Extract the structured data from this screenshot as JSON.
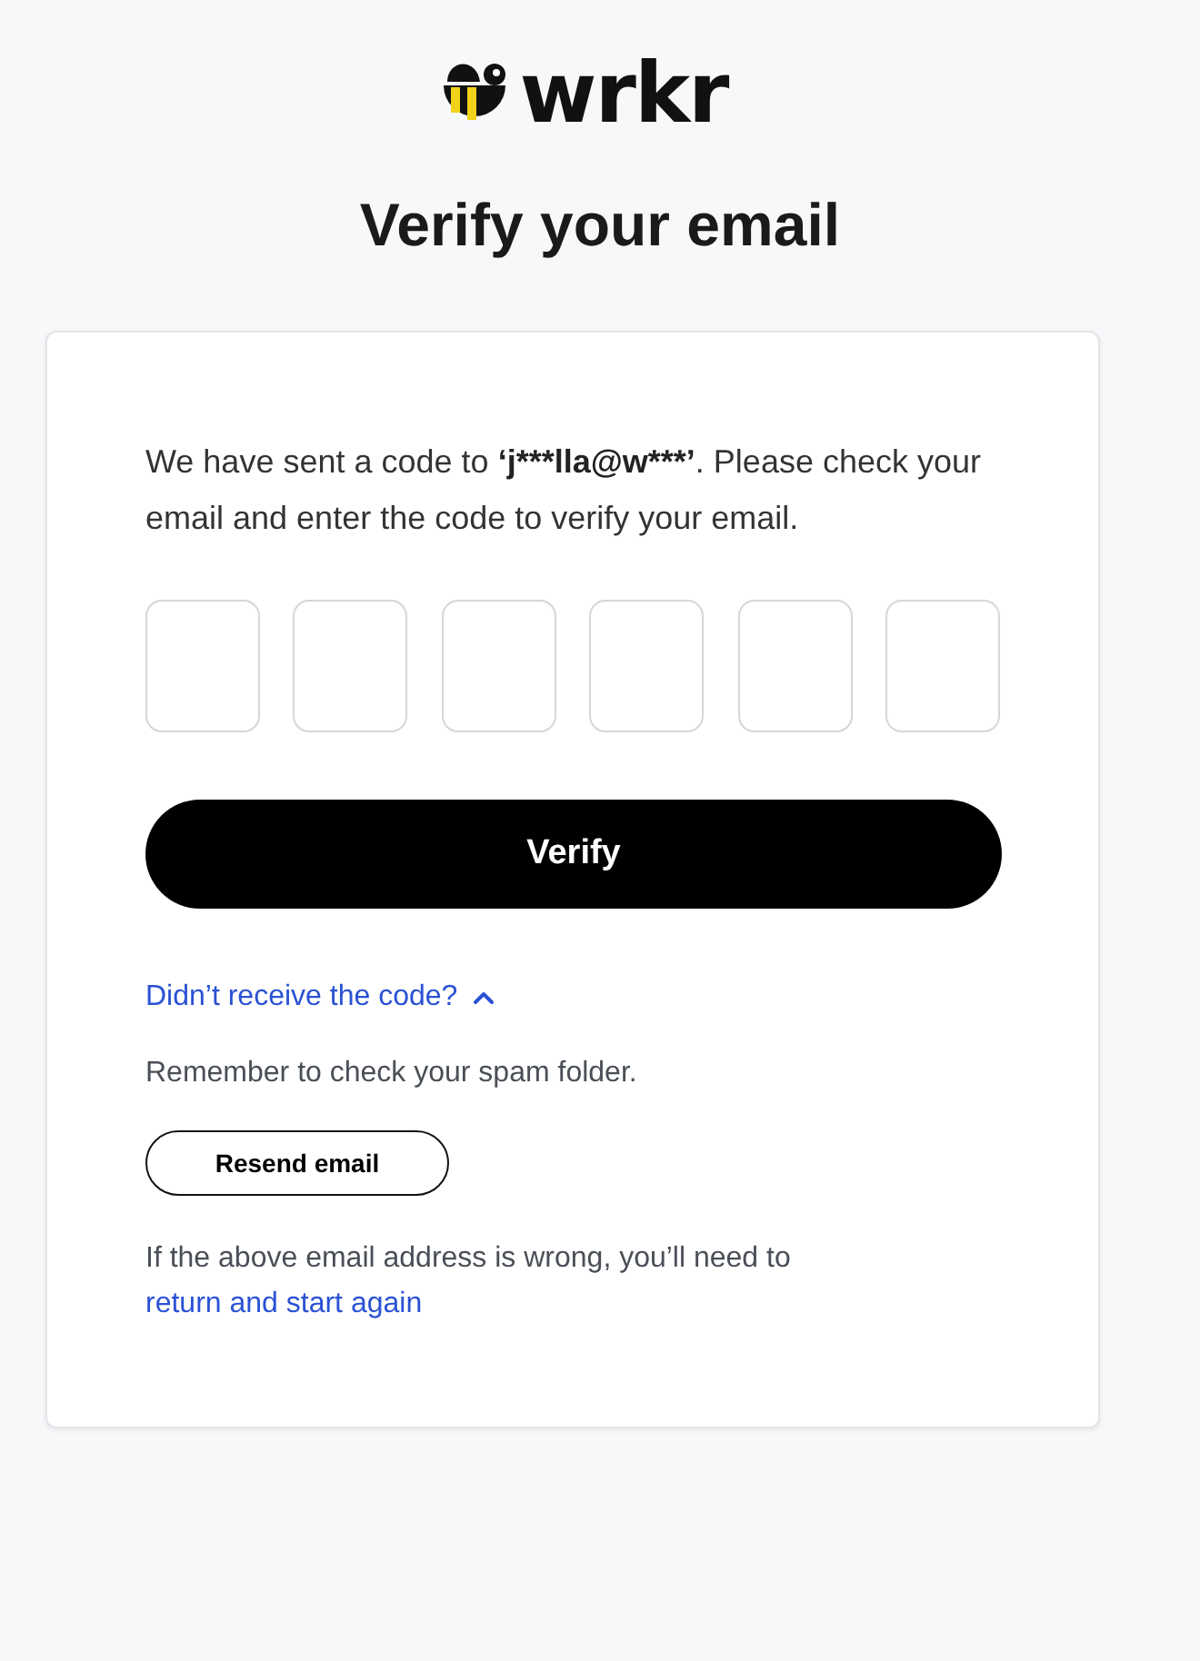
{
  "logo": {
    "text": "wrkr"
  },
  "title": "Verify your email",
  "card": {
    "message": {
      "before": "We have sent a code to",
      "email": "‘j***lla@w***’",
      "after": ". Please check your email and enter the code to verify your email."
    },
    "code_boxes": [
      {
        "kind": "digit"
      },
      {
        "kind": "digit"
      },
      {
        "kind": "digit"
      },
      {
        "kind": "digit"
      },
      {
        "kind": "digit"
      },
      {
        "kind": "digit"
      }
    ],
    "verify_button": "Verify",
    "help_toggle": {
      "label": "Didn’t receive the code?",
      "expanded": true
    },
    "help": {
      "note": "Remember to check your spam folder.",
      "resend_button": "Resend email",
      "footer": "If the above email address is wrong, you’ll need to",
      "footer_link": "return and start again"
    }
  }
}
